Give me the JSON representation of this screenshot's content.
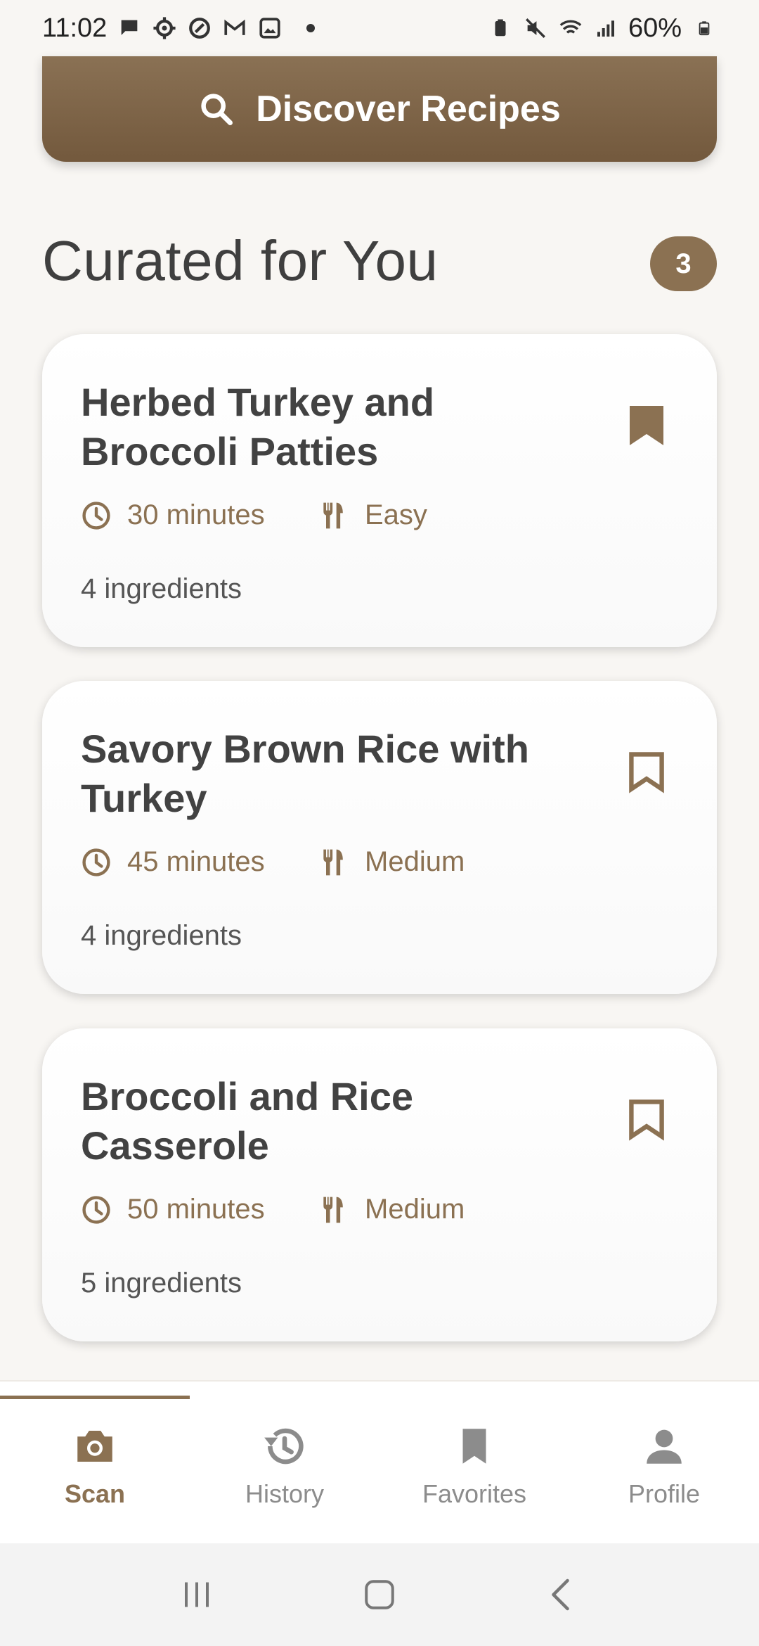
{
  "status_bar": {
    "time": "11:02",
    "battery": "60%",
    "left_icons": [
      "chat-bubble-icon",
      "settings-gear-icon",
      "maps-icon",
      "gmail-icon",
      "gallery-icon",
      "dot-icon"
    ],
    "right_icons": [
      "battery-saver-icon",
      "mute-icon",
      "wifi-icon",
      "signal-icon",
      "battery-icon"
    ]
  },
  "discover": {
    "label": "Discover Recipes",
    "icon": "search-icon"
  },
  "section": {
    "title": "Curated for You",
    "count": "3"
  },
  "recipes": [
    {
      "title": "Herbed Turkey and Broccoli Patties",
      "time": "30 minutes",
      "difficulty": "Easy",
      "ingredients": "4 ingredients",
      "bookmarked": true
    },
    {
      "title": "Savory Brown Rice with Turkey",
      "time": "45 minutes",
      "difficulty": "Medium",
      "ingredients": "4 ingredients",
      "bookmarked": false
    },
    {
      "title": "Broccoli and Rice Casserole",
      "time": "50 minutes",
      "difficulty": "Medium",
      "ingredients": "5 ingredients",
      "bookmarked": false
    }
  ],
  "nav": {
    "items": [
      {
        "label": "Scan",
        "icon": "camera-icon",
        "active": true
      },
      {
        "label": "History",
        "icon": "history-icon",
        "active": false
      },
      {
        "label": "Favorites",
        "icon": "bookmark-icon",
        "active": false
      },
      {
        "label": "Profile",
        "icon": "person-icon",
        "active": false
      }
    ]
  },
  "colors": {
    "accent": "#8b7152",
    "background": "#f8f6f3",
    "card": "#ffffff",
    "inactive": "#8c8c8c"
  }
}
